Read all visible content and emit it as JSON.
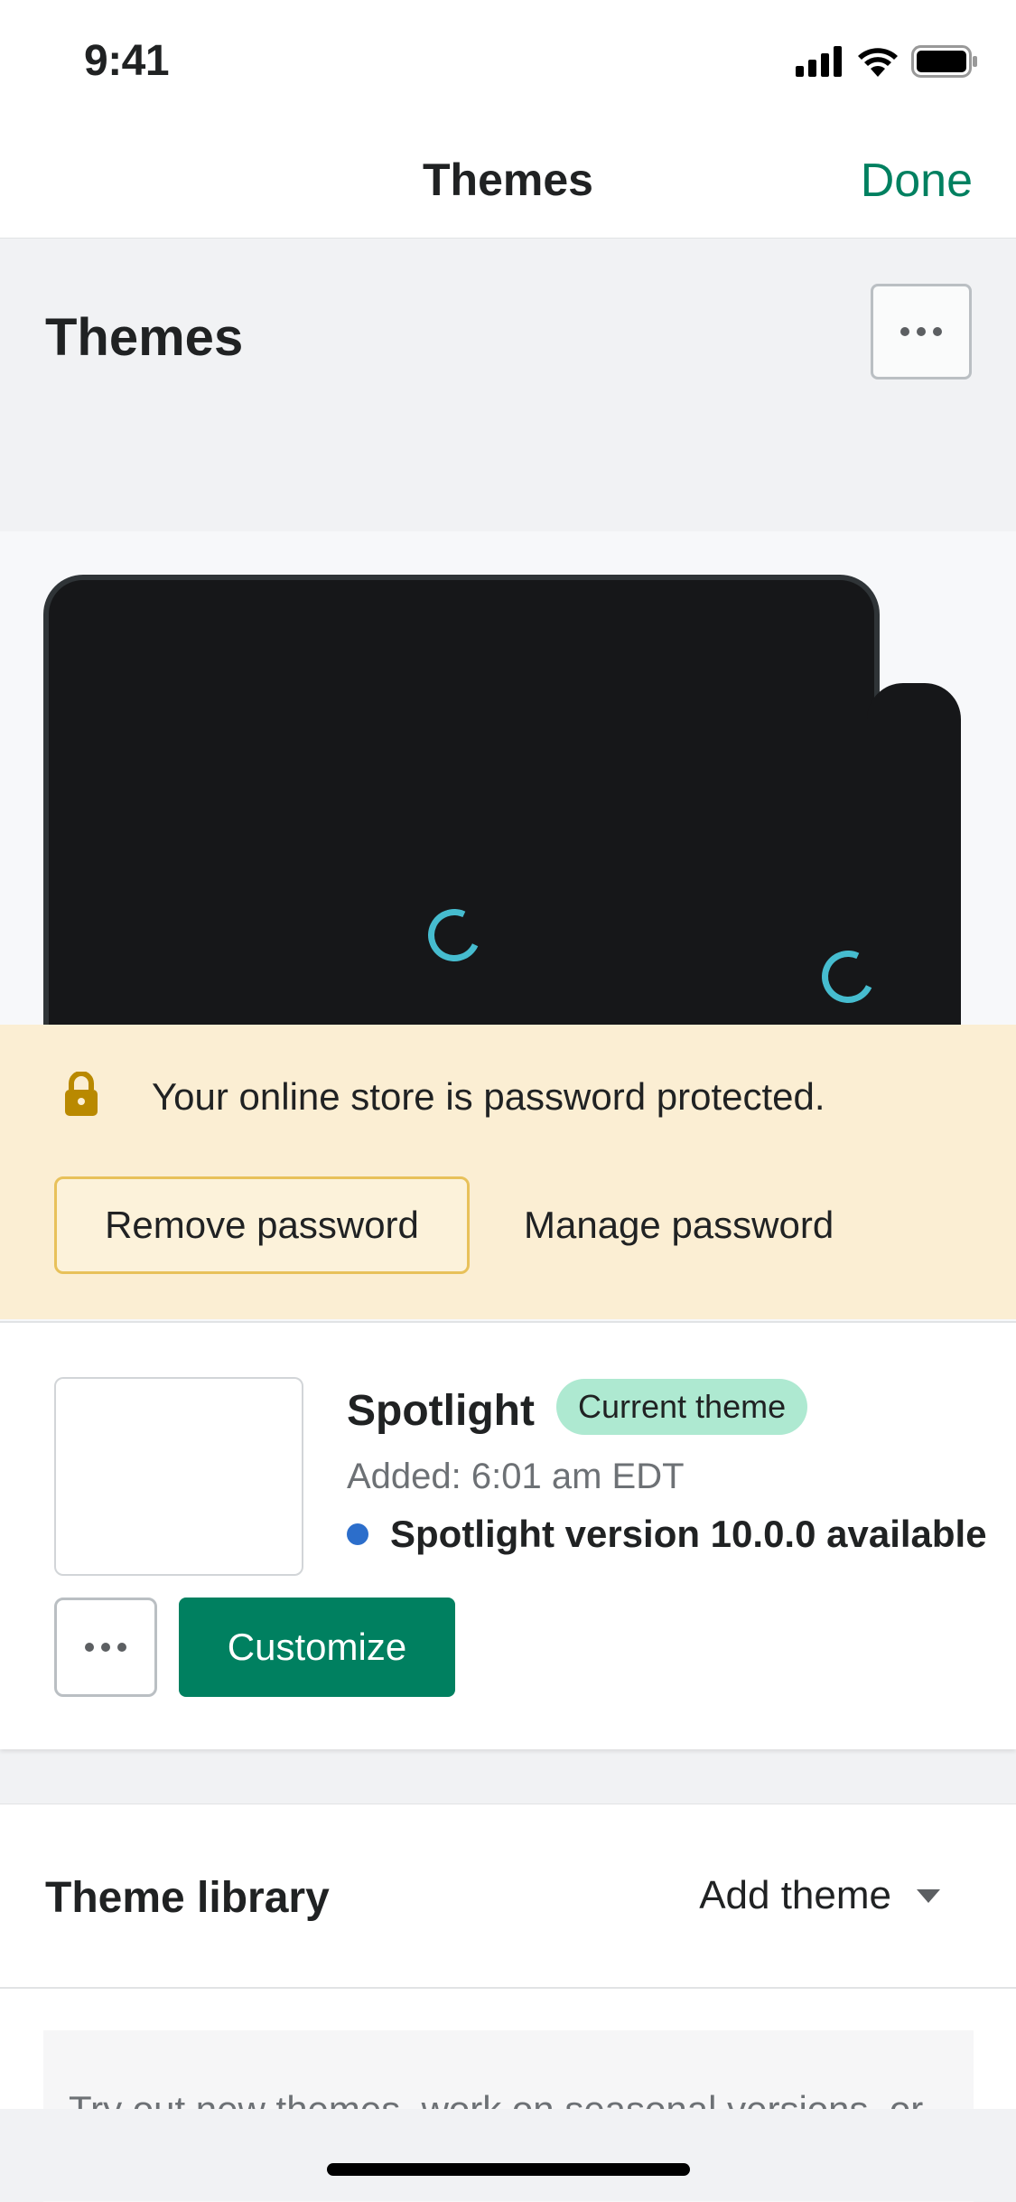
{
  "status_bar": {
    "time": "9:41"
  },
  "nav": {
    "title": "Themes",
    "done_label": "Done"
  },
  "page": {
    "title": "Themes"
  },
  "password_banner": {
    "message": "Your online store is password protected.",
    "remove_label": "Remove password",
    "manage_label": "Manage password"
  },
  "current_theme": {
    "name": "Spotlight",
    "badge": "Current theme",
    "added": "Added: 6:01 am EDT",
    "update_text": "Spotlight version 10.0.0 available",
    "customize_label": "Customize"
  },
  "library": {
    "title": "Theme library",
    "add_theme_label": "Add theme",
    "info_text": "Try out new themes, work on seasonal versions, or"
  },
  "colors": {
    "accent": "#008060",
    "banner_bg": "#fbeed3",
    "badge_bg": "#aee9d1",
    "update_dot": "#2c6ecb",
    "spinner": "#46bccf"
  }
}
